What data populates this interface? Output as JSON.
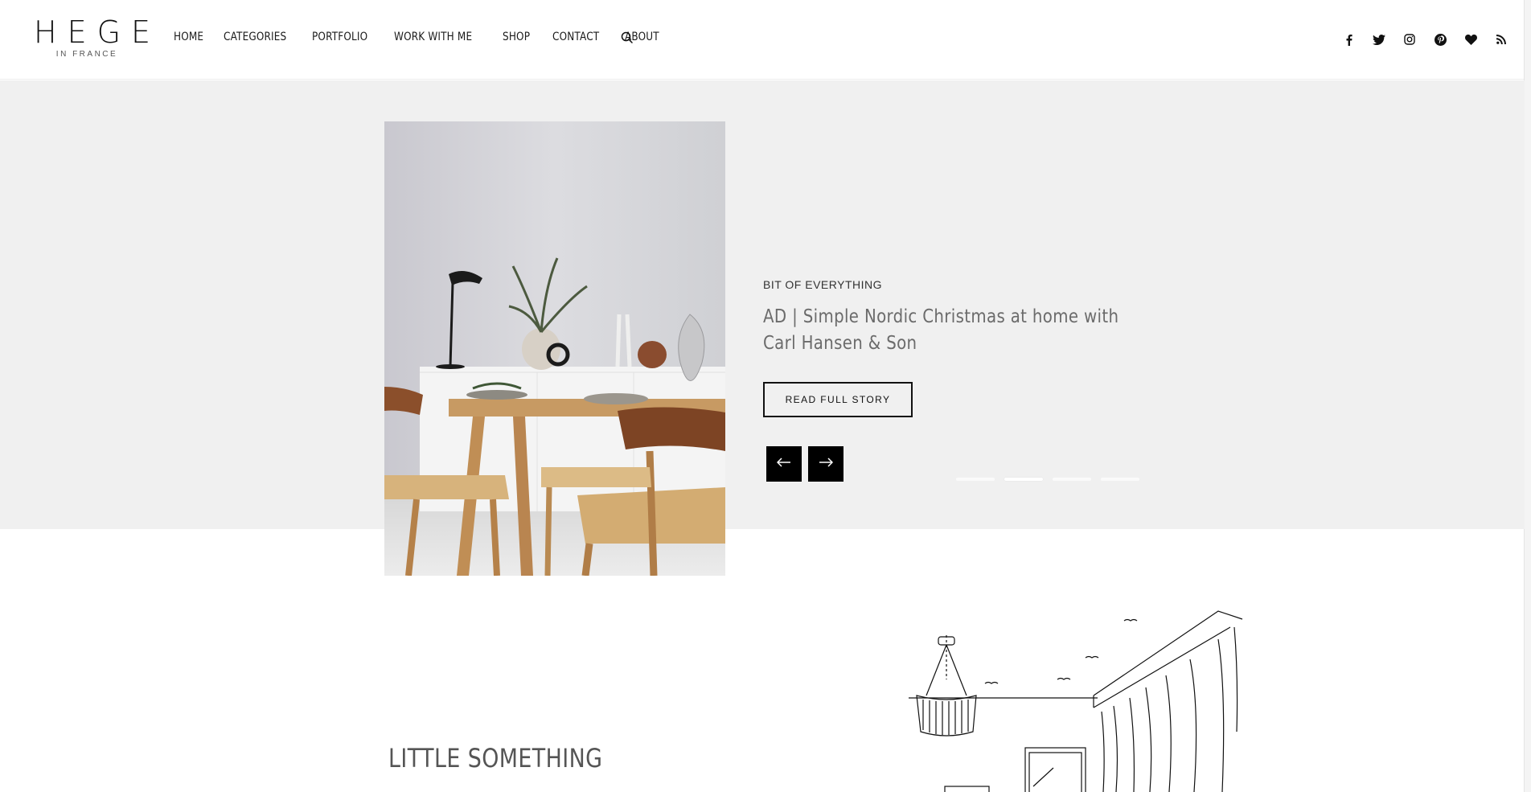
{
  "logo": {
    "main": "HEGE",
    "sub": "IN FRANCE"
  },
  "nav": {
    "items": [
      {
        "label": "HOME"
      },
      {
        "label": "CATEGORIES"
      },
      {
        "label": "PORTFOLIO"
      },
      {
        "label": "WORK WITH ME"
      },
      {
        "label": "SHOP"
      },
      {
        "label": "CONTACT"
      },
      {
        "label": "ABOUT"
      }
    ],
    "search_icon": "search-icon"
  },
  "social": [
    "facebook-icon",
    "twitter-icon",
    "instagram-icon",
    "pinterest-icon",
    "bloglovin-heart-icon",
    "rss-icon"
  ],
  "hero": {
    "category": "BIT OF EVERYTHING",
    "title": "AD | Simple Nordic Christmas at home with Carl Hansen & Son",
    "button": "READ FULL STORY",
    "prev_icon": "arrow-left-icon",
    "next_icon": "arrow-right-icon",
    "slide_count": 4,
    "active_slide": 2
  },
  "section": {
    "heading": "LITTLE SOMETHING"
  },
  "colors": {
    "hero_bg": "#f0f0f0",
    "button_dark": "#000000",
    "title_gray": "#6b6b6b"
  }
}
